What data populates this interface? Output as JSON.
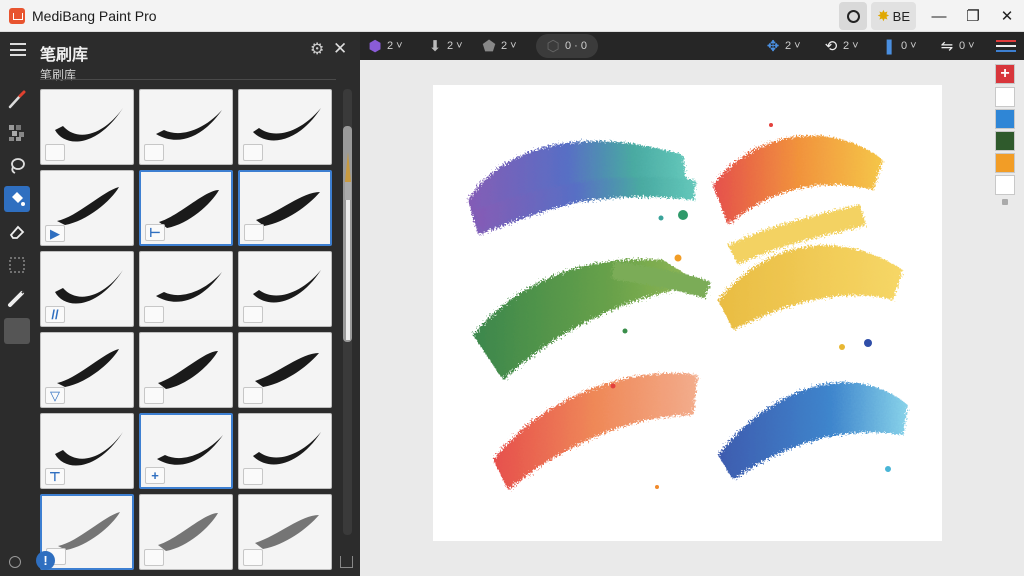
{
  "window": {
    "title": "MediBang Paint Pro",
    "theme_button": "BE"
  },
  "panel": {
    "title": "笔刷库",
    "subtitle": "笔刷库",
    "tile_tags": [
      "",
      "",
      "",
      "▶",
      "⊢",
      "",
      "//",
      "",
      "",
      "▽",
      "",
      "",
      "⊤",
      "+",
      "",
      "",
      "",
      ""
    ]
  },
  "toolbar": {
    "items": [
      {
        "icon": "layer-color-icon",
        "value": "2"
      },
      {
        "icon": "arrow-down-icon",
        "value": "2"
      },
      {
        "icon": "blob-icon",
        "value": "2"
      },
      {
        "icon": "selection-icon",
        "value": "0 · 0"
      },
      {
        "icon": "transform-icon",
        "value": "2"
      },
      {
        "icon": "rotate-icon",
        "value": "2"
      },
      {
        "icon": "blue-brush-icon",
        "value": "0"
      },
      {
        "icon": "flip-icon",
        "value": "0"
      }
    ]
  },
  "palette": {
    "colors": [
      "#ffffff",
      "#2f86d6",
      "#2f5a2c",
      "#f29d26",
      "#ffffff"
    ],
    "add_color": "#d8363b"
  },
  "accent": "#2f6fc0"
}
